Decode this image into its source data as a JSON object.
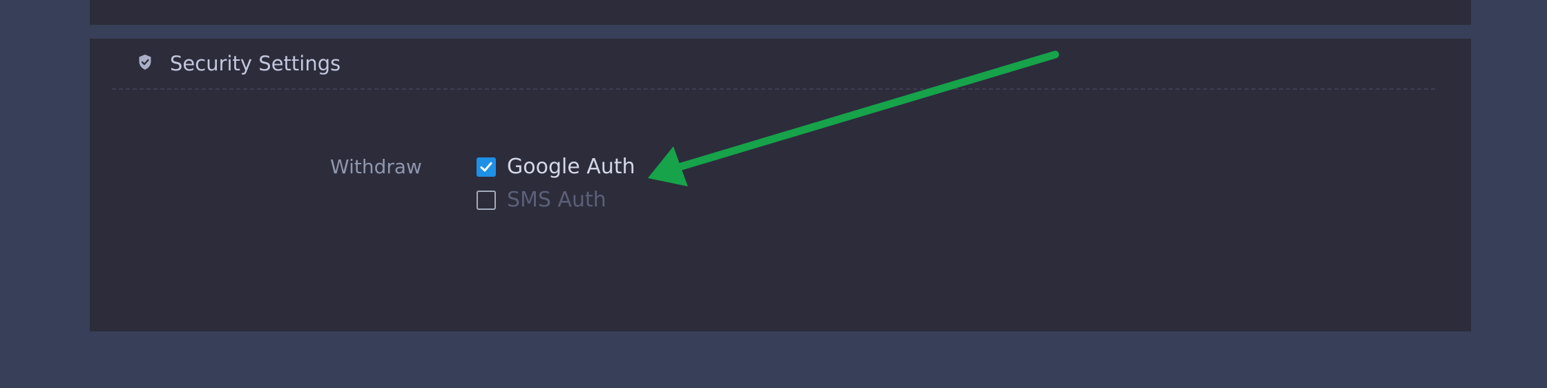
{
  "security": {
    "title": "Security Settings",
    "icon": "shield-check-icon",
    "withdraw": {
      "label": "Withdraw",
      "options": [
        {
          "label": "Google Auth",
          "checked": true
        },
        {
          "label": "SMS Auth",
          "checked": false
        }
      ]
    }
  },
  "colors": {
    "background": "#383f58",
    "panel": "#2c2c3b",
    "checkbox_accent": "#1e90e6",
    "annotation_arrow": "#16a34a"
  }
}
